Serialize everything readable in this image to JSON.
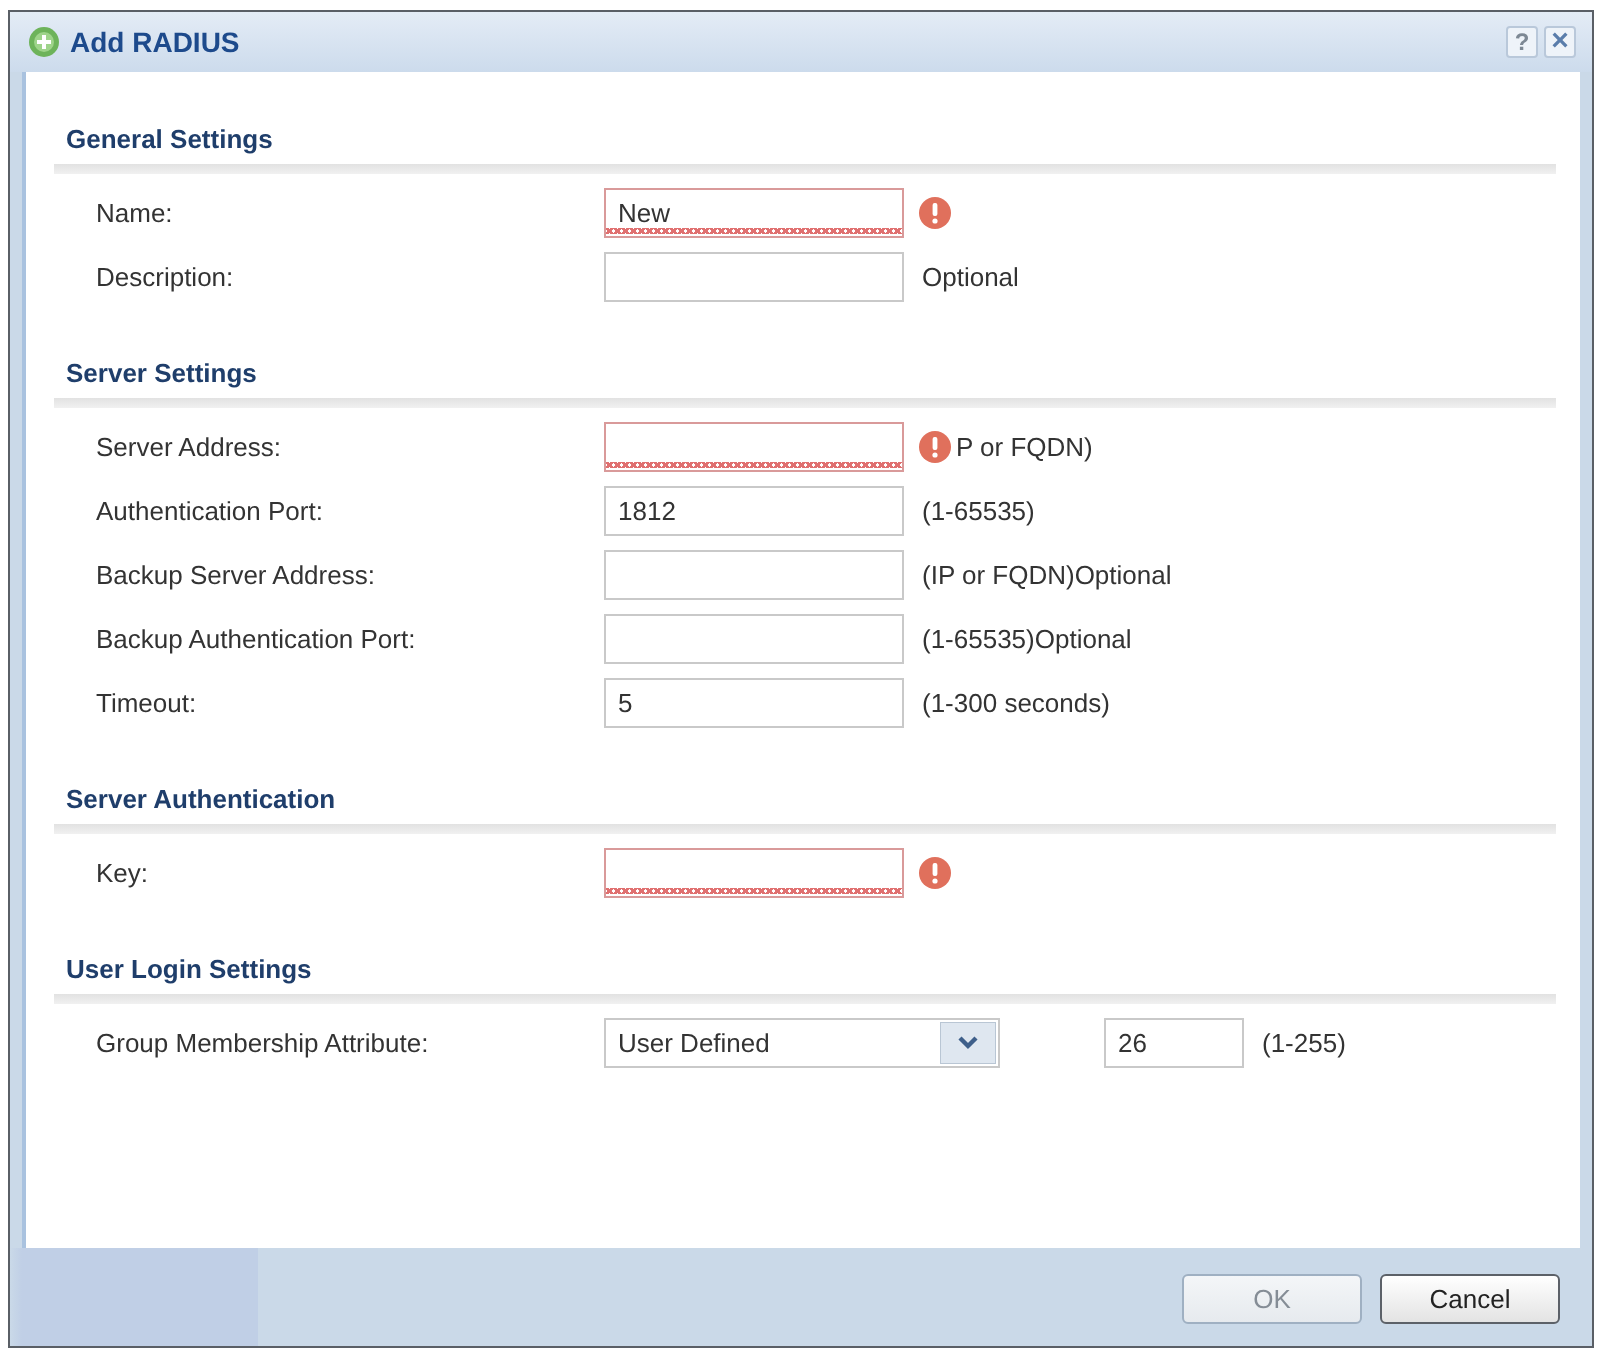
{
  "window": {
    "title": "Add RADIUS",
    "help": "?",
    "close": "×"
  },
  "sections": [
    {
      "title": "General Settings",
      "rows": [
        {
          "label": "Name:",
          "kind": "text",
          "value": "New",
          "invalid": true
        },
        {
          "label": "Description:",
          "kind": "text",
          "invalid": false,
          "hint": "Optional"
        }
      ]
    },
    {
      "title": "Server Settings",
      "rows": [
        {
          "label": "Server Address:",
          "kind": "text",
          "invalid": true,
          "hint": "P or FQDN)"
        },
        {
          "label": "Authentication Port:",
          "kind": "text",
          "value": "1812",
          "invalid": false,
          "hint": "(1-65535)"
        },
        {
          "label": "Backup Server Address:",
          "kind": "text",
          "invalid": false,
          "hint": "(IP or FQDN)Optional"
        },
        {
          "label": "Backup Authentication Port:",
          "kind": "text",
          "invalid": false,
          "hint": "(1-65535)Optional"
        },
        {
          "label": "Timeout:",
          "kind": "text",
          "value": "5",
          "invalid": false,
          "hint": "(1-300 seconds)"
        }
      ]
    },
    {
      "title": "Server Authentication",
      "rows": [
        {
          "label": "Key:",
          "kind": "text",
          "invalid": true
        }
      ]
    },
    {
      "title": "User Login Settings",
      "rows": [
        {
          "label": "Group Membership Attribute:",
          "kind": "select",
          "value": "User Defined",
          "invalid": false,
          "number": {
            "value": "26"
          },
          "hint": "(1-255)"
        }
      ]
    }
  ],
  "buttons": [
    {
      "label": "OK",
      "disabled": true
    },
    {
      "label": "Cancel",
      "disabled": false
    }
  ]
}
